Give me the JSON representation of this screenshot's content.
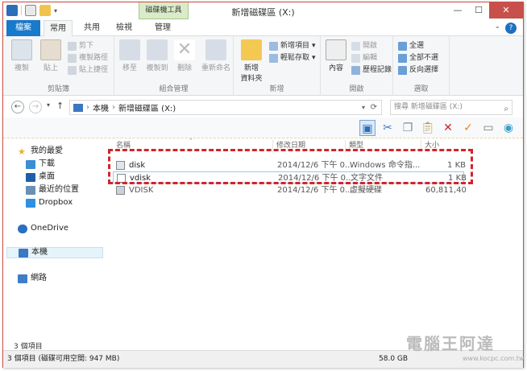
{
  "window": {
    "title": "新增磁碟區 (X:)"
  },
  "titlebar": {
    "contextual_group": "磁碟機工具"
  },
  "tabs": [
    {
      "label": "檔案"
    },
    {
      "label": "常用"
    },
    {
      "label": "共用"
    },
    {
      "label": "檢視"
    },
    {
      "label": "管理"
    }
  ],
  "ribbon": {
    "clipboard": {
      "copy": "複製",
      "paste": "貼上",
      "cut": "剪下",
      "copy_path": "複製路徑",
      "paste_shortcut": "貼上捷徑",
      "group": "剪貼簿"
    },
    "organize": {
      "move_to": "移至",
      "copy_to": "複製到",
      "delete": "刪除",
      "rename": "重新命名",
      "group": "組合管理"
    },
    "new": {
      "new_folder": "新增\n資料夾",
      "new_item": "新增項目",
      "easy_access": "輕鬆存取",
      "group": "新增"
    },
    "open": {
      "properties": "內容",
      "open": "開啟",
      "edit": "編輯",
      "history": "歷程記錄",
      "group": "開啟"
    },
    "select": {
      "select_all": "全選",
      "select_none": "全部不選",
      "invert": "反向選擇",
      "group": "選取"
    }
  },
  "address": {
    "path": [
      "本機",
      "新增磁碟區 (X:)"
    ],
    "search_placeholder": "搜尋 新增磁碟區 (X:)"
  },
  "nav": {
    "favorites": "我的最愛",
    "items": [
      "下載",
      "桌面",
      "最近的位置",
      "Dropbox"
    ],
    "onedrive": "OneDrive",
    "this_pc": "本機",
    "network": "網路"
  },
  "list": {
    "columns": [
      "名稱",
      "修改日期",
      "類型",
      "大小"
    ],
    "rows": [
      {
        "name": "disk",
        "date": "2014/12/6 下午 0...",
        "type": "Windows 命令指...",
        "size": "1 KB"
      },
      {
        "name": "vdisk",
        "date": "2014/12/6 下午 0...",
        "type": "文字文件",
        "size": "1 KB"
      },
      {
        "name": "VDISK",
        "date": "2014/12/6 下午 0...",
        "type": "虛擬硬碟",
        "size": "60,811,40..."
      }
    ]
  },
  "status": {
    "count": "3 個項目",
    "summary": "3 個項目 (磁碟可用空間: 947 MB)",
    "free": "58.0 GB"
  },
  "watermark": {
    "brand": "電腦王阿達",
    "url": "www.kocpc.com.tw"
  }
}
